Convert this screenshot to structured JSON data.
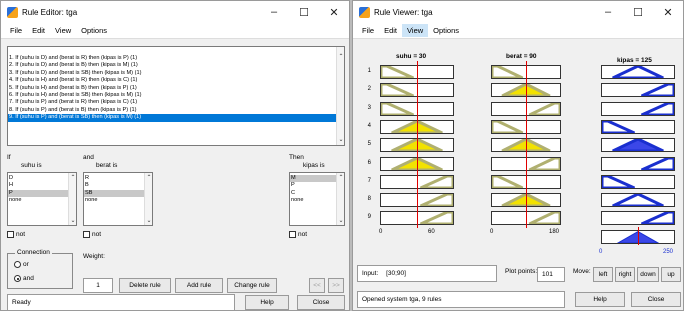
{
  "editor": {
    "title": "Rule Editor: tga",
    "menu": [
      "File",
      "Edit",
      "View",
      "Options"
    ],
    "rules": [
      "1. If (suhu is D) and (berat is R) then (kipas is P) (1)",
      "2. If (suhu is D) and (berat is B) then (kipas is M) (1)",
      "3. If (suhu is D) and (berat is SB) then (kipas is M) (1)",
      "4. If (suhu is H) and (berat is R) then (kipas is C) (1)",
      "5. If (suhu is H) and (berat is B) then (kipas is P) (1)",
      "6. If (suhu is H) and (berat is SB) then (kipas is M) (1)",
      "7. If (suhu is P) and (berat is R) then (kipas is C) (1)",
      "8. If (suhu is P) and (berat is B) then (kipas is P) (1)",
      "9. If (suhu is P) and (berat is SB) then (kipas is M) (1)"
    ],
    "if_label": "If",
    "and_label": "and",
    "then_label": "Then",
    "suhu_label": "suhu is",
    "berat_label": "berat is",
    "kipas_label": "kipas is",
    "suhu_options": [
      "D",
      "H",
      "P",
      "none"
    ],
    "berat_options": [
      "R",
      "B",
      "SB",
      "none"
    ],
    "kipas_options": [
      "M",
      "P",
      "C",
      "none"
    ],
    "not_label": "not",
    "connection_label": "Connection",
    "or_label": "or",
    "and_radio_label": "and",
    "weight_label": "Weight:",
    "weight_value": "1",
    "delete_rule": "Delete rule",
    "add_rule": "Add rule",
    "change_rule": "Change rule",
    "prev": "<<",
    "next": ">>",
    "status": "Ready",
    "help": "Help",
    "close": "Close"
  },
  "viewer": {
    "title": "Rule Viewer: tga",
    "menu": [
      "File",
      "Edit",
      "View",
      "Options"
    ],
    "col_suhu": "suhu = 30",
    "col_berat": "berat = 90",
    "col_kipas": "kipas = 125",
    "row_numbers": [
      "1",
      "2",
      "3",
      "4",
      "5",
      "6",
      "7",
      "8",
      "9"
    ],
    "suhu_axis": [
      "0",
      "60"
    ],
    "berat_axis": [
      "0",
      "180"
    ],
    "kipas_axis": [
      "0",
      "250"
    ],
    "input_label": "Input:",
    "input_value": "[30;90]",
    "plot_points_label": "Plot points:",
    "plot_points_value": "101",
    "move_label": "Move:",
    "move_buttons": [
      "left",
      "right",
      "down",
      "up"
    ],
    "status": "Opened system tga, 9 rules",
    "help": "Help",
    "close": "Close"
  }
}
